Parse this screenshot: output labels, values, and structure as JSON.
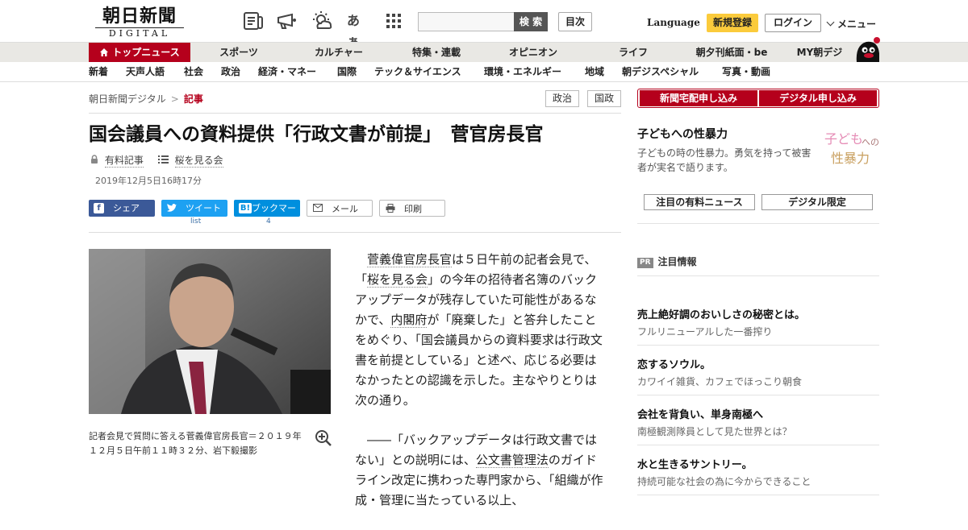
{
  "header": {
    "logo_main": "朝日新聞",
    "logo_sub": "DIGITAL",
    "search_button": "検 索",
    "search_placeholder": "",
    "mokuji": "目次",
    "language": "Language",
    "signup": "新規登録",
    "login": "ログイン",
    "menu": "メニュー",
    "icons": [
      "newspaper-list-icon",
      "megaphone-icon",
      "weather-icon",
      "font-size-icon",
      "grid-apps-icon"
    ],
    "font_icon_text": "あぁ"
  },
  "nav_primary": [
    {
      "label": "トップニュース",
      "active": true
    },
    {
      "label": "スポーツ"
    },
    {
      "label": "カルチャー"
    },
    {
      "label": "特集・連載"
    },
    {
      "label": "オピニオン"
    },
    {
      "label": "ライフ"
    },
    {
      "label": "朝夕刊紙面・be"
    },
    {
      "label": "MY朝デジ"
    }
  ],
  "nav_secondary": [
    "新着",
    "天声人語",
    "社会",
    "政治",
    "経済・マネー",
    "国際",
    "テック＆サイエンス",
    "環境・エネルギー",
    "地域",
    "朝デジスペシャル",
    "写真・動画"
  ],
  "breadcrumb": {
    "home": "朝日新聞デジタル",
    "sep": ">",
    "current": "記事"
  },
  "tags": [
    "政治",
    "国政"
  ],
  "article": {
    "title": "国会議員への資料提供「行政文書が前提」　菅官房長官",
    "paid_label": "有料記事",
    "series_label": "桜を見る会",
    "date": "2019年12月5日16時17分",
    "share": {
      "facebook": "シェア",
      "twitter": "ツイート",
      "hatena": "ブックマーク",
      "mail": "メール",
      "print": "印刷",
      "twitter_count": "list",
      "hatena_count": "4"
    },
    "caption": "記者会見で質問に答える菅義偉官房長官＝２０１９年１２月５日午前１１時３２分、岩下毅撮影",
    "p1": {
      "link1": "菅義偉官房長官",
      "t1": "は５日午前の記者会見で、「",
      "link2": "桜を見る会",
      "t2": "」の今年の招待者名簿のバックアップデータが残存していた可能性があるなかで、",
      "link3": "内閣府",
      "t3": "が「廃棄した」と答弁したことをめぐり、「国会議員からの資料要求は行政文書を前提としている」と述べ、応じる必要はなかったとの認識を示した。主なやりとりは次の通り。"
    },
    "p2": {
      "t1": "――「バックアップデータは行政文書ではない」との説明には、",
      "link1": "公文書管理法",
      "t2": "のガイドライン改定に携わった専門家から、「組織が作成・管理に当たっている以上、"
    }
  },
  "sidebar": {
    "btn_delivery": "新聞宅配申し込み",
    "btn_digital": "デジタル申し込み",
    "feature_title": "子どもへの性暴力",
    "feature_desc": "子どもの時の性暴力。勇気を持って被害者が実名で語ります。",
    "feature_logo_1": "子ども",
    "feature_logo_2": "への",
    "feature_logo_3": "性暴力",
    "btn_paid_news": "注目の有料ニュース",
    "btn_digital_only": "デジタル限定",
    "pr_badge": "PR",
    "pr_label": "注目情報",
    "ads": [
      {
        "title": "売上絶好調のおいしさの秘密とは。",
        "sub": "フルリニューアルした一番搾り"
      },
      {
        "title": "恋するソウル。",
        "sub": "カワイイ雑貨、カフェでほっこり朝食"
      },
      {
        "title": "会社を背負い、単身南極へ",
        "sub": "南極観測隊員として見た世界とは？"
      },
      {
        "title": "水と生きるサントリー。",
        "sub": "持続可能な社会の為に今からできること"
      }
    ]
  },
  "colors": {
    "brand_red": "#b5001c",
    "signup_yellow": "#fbcb3c",
    "facebook": "#3b5998",
    "twitter": "#1da1f2",
    "hatena": "#008fde"
  }
}
